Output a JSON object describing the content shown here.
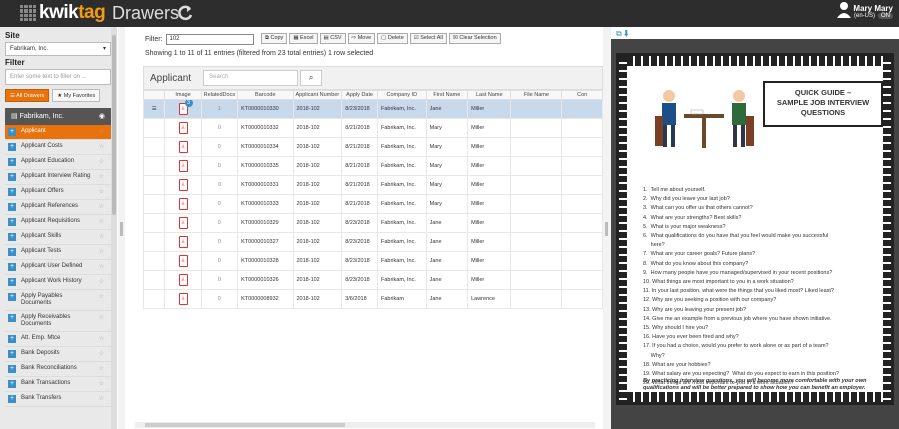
{
  "header": {
    "logo_main": "kwik",
    "logo_accent": "tag",
    "app_name": "Drawers",
    "user_name": "Mary Mary",
    "locale": "(en-US)",
    "toggle_label": "ON"
  },
  "sidebar": {
    "site_label": "Site",
    "site_value": "Fabrikam, Inc.",
    "filter_label": "Filter",
    "filter_placeholder": "Enter some text to filter on ...",
    "tab_all": "All Drawers",
    "tab_fav": "My Favorites",
    "group": "Fabrikam, Inc.",
    "items": [
      "Applicant",
      "Applicant Costs",
      "Applicant Education",
      "Applicant Interview Rating",
      "Applicant Offers",
      "Applicant References",
      "Applicant Requisitions",
      "Applicant Skills",
      "Applicant Tests",
      "Applicant User Defined",
      "Applicant Work History",
      "Apply Payables Documents",
      "Apply Receivables Documents",
      "Att. Emp. Mtce",
      "Bank Deposits",
      "Bank Reconciliations",
      "Bank Transactions",
      "Bank Transfers"
    ]
  },
  "toolbar": {
    "filter_label": "Filter:",
    "filter_value": "102",
    "copy": "Copy",
    "excel": "Excel",
    "csv": "CSV",
    "move": "Move",
    "delete": "Delete",
    "select_all": "Select All",
    "clear": "Clear Selection"
  },
  "summary": "Showing 1 to 11 of 11 entries (filtered from 23 total entries) 1 row selected",
  "grid": {
    "title": "Applicant",
    "search_placeholder": "Search",
    "columns": [
      "Image",
      "RelatedDocs",
      "Barcode",
      "Applicant Number",
      "Apply Date",
      "Company ID",
      "First Name",
      "Last Name",
      "File Name",
      "Con"
    ],
    "rows": [
      {
        "badge": "3",
        "related": "1",
        "barcode": "KT0000010330",
        "num": "2018-102",
        "date": "8/23/2018",
        "company": "Fabrikam, Inc.",
        "first": "Jane",
        "last": "Miller"
      },
      {
        "badge": "",
        "related": "0",
        "barcode": "KT0000010332",
        "num": "2018-102",
        "date": "8/21/2018",
        "company": "Fabrikam, Inc.",
        "first": "Mary",
        "last": "Miller"
      },
      {
        "badge": "",
        "related": "0",
        "barcode": "KT0000010334",
        "num": "2018-102",
        "date": "8/21/2018",
        "company": "Fabrikam, Inc.",
        "first": "Mary",
        "last": "Miller"
      },
      {
        "badge": "",
        "related": "0",
        "barcode": "KT0000010335",
        "num": "2018-102",
        "date": "8/21/2018",
        "company": "Fabrikam, Inc.",
        "first": "Mary",
        "last": "Miller"
      },
      {
        "badge": "",
        "related": "0",
        "barcode": "KT0000010331",
        "num": "2018-102",
        "date": "8/21/2018",
        "company": "Fabrikam, Inc.",
        "first": "Mary",
        "last": "Miller"
      },
      {
        "badge": "",
        "related": "0",
        "barcode": "KT0000010333",
        "num": "2018-102",
        "date": "8/21/2018",
        "company": "Fabrikam, Inc.",
        "first": "Mary",
        "last": "Miller"
      },
      {
        "badge": "",
        "related": "0",
        "barcode": "KT0000010329",
        "num": "2018-102",
        "date": "8/23/2018",
        "company": "Fabrikam, Inc.",
        "first": "Jane",
        "last": "Miller"
      },
      {
        "badge": "",
        "related": "0",
        "barcode": "KT0000010327",
        "num": "2018-102",
        "date": "8/23/2018",
        "company": "Fabrikam, Inc.",
        "first": "Jane",
        "last": "Miller"
      },
      {
        "badge": "",
        "related": "0",
        "barcode": "KT0000010328",
        "num": "2018-102",
        "date": "8/23/2018",
        "company": "Fabrikam, Inc.",
        "first": "Jane",
        "last": "Miller"
      },
      {
        "badge": "",
        "related": "0",
        "barcode": "KT0000010326",
        "num": "2018-102",
        "date": "8/23/2018",
        "company": "Fabrikam, Inc.",
        "first": "Jane",
        "last": "Miller"
      },
      {
        "badge": "",
        "related": "0",
        "barcode": "KT0000008932",
        "num": "2018-102",
        "date": "3/6/2018",
        "company": "Fabrikam",
        "first": "Jane",
        "last": "Lawrence"
      }
    ]
  },
  "document": {
    "title_line1": "QUICK GUIDE –",
    "title_line2": "SAMPLE JOB INTERVIEW",
    "title_line3": "QUESTIONS",
    "questions": [
      "1.  Tell me about yourself.",
      "2.  Why did you leave your last job?",
      "3.  What can you offer us that others cannot?",
      "4.  What are your strengths? Best skills?",
      "5.  What is your major weakness?",
      "6.  What qualifications do you have that you feel would make you successful",
      "     here?",
      "7.  What are your career goals? Future plans?",
      "8.  What do you know about this company?",
      "9.  How many people have you managed/supervised in your recent positions?",
      "10. What things are most important to you in a work situation?",
      "11. In your last position, what were the things that you liked most? Liked least?",
      "12. Why are you seeking a position with our company?",
      "13. Why are you leaving your present job?",
      "14. Give me an example from a previous job where you have shown initiative.",
      "15. Why should I hire you?",
      "16. Have you ever been fired and why?",
      "17. If you had a choice, would you prefer to work alone or as part of a team?",
      "     Why?",
      "18. What are your hobbies?",
      "19. What salary are you expecting?  What do you expect to earn in this position?",
      "20. What things are most important to you in a work situation?"
    ],
    "closing": "By practicing interview questions, you will become more comfortable with your own qualifications and will be better prepared to show how you can benefit an employer."
  }
}
